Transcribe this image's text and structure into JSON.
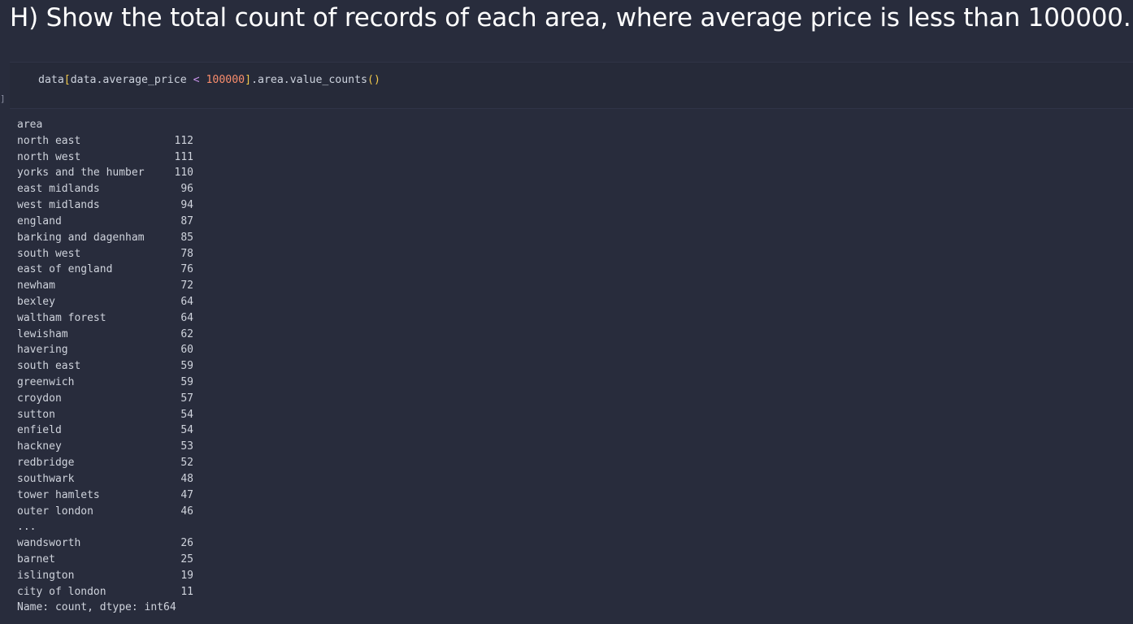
{
  "heading": "H) Show the total count of records of each area, where average price is less than 100000.",
  "cell": {
    "exec_marker": "]",
    "code": {
      "var": "data",
      "open_bracket": "[",
      "filter": "data.average_price ",
      "op": "<",
      "space": " ",
      "number": "100000",
      "close_bracket": "]",
      "method": ".area.value_counts",
      "parens": "()"
    }
  },
  "output": {
    "index_name": "area",
    "rows": [
      {
        "label": "north east",
        "value": "112"
      },
      {
        "label": "north west",
        "value": "111"
      },
      {
        "label": "yorks and the humber",
        "value": "110"
      },
      {
        "label": "east midlands",
        "value": "96"
      },
      {
        "label": "west midlands",
        "value": "94"
      },
      {
        "label": "england",
        "value": "87"
      },
      {
        "label": "barking and dagenham",
        "value": "85"
      },
      {
        "label": "south west",
        "value": "78"
      },
      {
        "label": "east of england",
        "value": "76"
      },
      {
        "label": "newham",
        "value": "72"
      },
      {
        "label": "bexley",
        "value": "64"
      },
      {
        "label": "waltham forest",
        "value": "64"
      },
      {
        "label": "lewisham",
        "value": "62"
      },
      {
        "label": "havering",
        "value": "60"
      },
      {
        "label": "south east",
        "value": "59"
      },
      {
        "label": "greenwich",
        "value": "59"
      },
      {
        "label": "croydon",
        "value": "57"
      },
      {
        "label": "sutton",
        "value": "54"
      },
      {
        "label": "enfield",
        "value": "54"
      },
      {
        "label": "hackney",
        "value": "53"
      },
      {
        "label": "redbridge",
        "value": "52"
      },
      {
        "label": "southwark",
        "value": "48"
      },
      {
        "label": "tower hamlets",
        "value": "47"
      },
      {
        "label": "outer london",
        "value": "46"
      },
      {
        "label": "...",
        "value": ""
      },
      {
        "label": "wandsworth",
        "value": "26"
      },
      {
        "label": "barnet",
        "value": "25"
      },
      {
        "label": "islington",
        "value": "19"
      },
      {
        "label": "city of london",
        "value": "11"
      }
    ],
    "dtype_line": "Name: count, dtype: int64"
  }
}
